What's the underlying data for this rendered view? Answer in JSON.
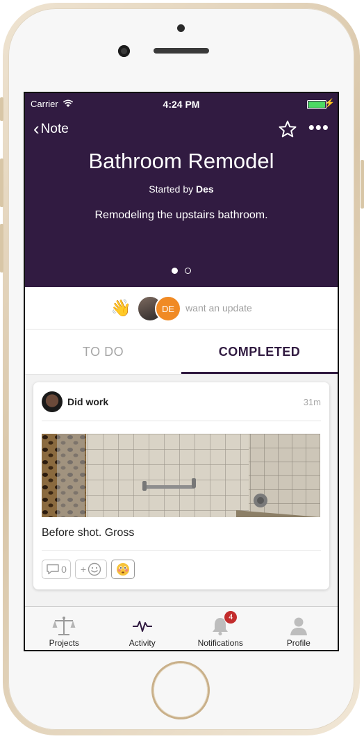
{
  "status_bar": {
    "carrier": "Carrier",
    "time": "4:24 PM"
  },
  "nav": {
    "back_label": "Note"
  },
  "project": {
    "title": "Bathroom Remodel",
    "started_prefix": "Started by",
    "started_by": "Des",
    "description": "Remodeling the upstairs bathroom.",
    "page_count": 2,
    "current_page": 1
  },
  "update_request": {
    "avatar2_initials": "DE",
    "text": "want an update"
  },
  "tabs": {
    "todo": "TO DO",
    "completed": "COMPLETED",
    "selected": "completed"
  },
  "card": {
    "title": "Did work",
    "time": "31m",
    "caption": "Before shot. Gross",
    "comment_count": "0",
    "react_add": "+"
  },
  "tabbar": {
    "items": [
      {
        "label": "Projects",
        "icon": "scales-icon"
      },
      {
        "label": "Activity",
        "icon": "pulse-icon"
      },
      {
        "label": "Notifications",
        "icon": "bell-icon",
        "badge": "4"
      },
      {
        "label": "Profile",
        "icon": "person-icon"
      }
    ]
  },
  "colors": {
    "header": "#311b41",
    "accent": "#f08a24",
    "badge": "#c32d2d"
  }
}
